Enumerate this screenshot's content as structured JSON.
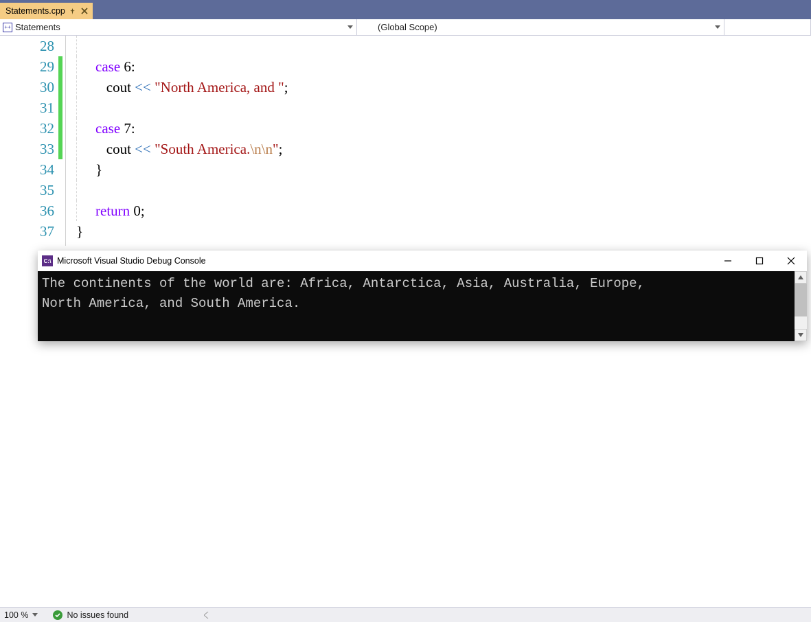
{
  "tab": {
    "filename": "Statements.cpp"
  },
  "scope": {
    "breadcrumb": "Statements",
    "scope_label": "(Global Scope)"
  },
  "code": {
    "lines": [
      {
        "n": "28"
      },
      {
        "n": "29",
        "kw": "case",
        "num": "6",
        "colon": ":"
      },
      {
        "n": "30",
        "id": "cout ",
        "op": "<<",
        "str_open": " \"",
        "str": "North America, and ",
        "str_close": "\"",
        "semi": ";"
      },
      {
        "n": "31"
      },
      {
        "n": "32",
        "kw": "case",
        "num": "7",
        "colon": ":"
      },
      {
        "n": "33",
        "id": "cout ",
        "op": "<<",
        "str_open": " \"",
        "str": "South America.",
        "esc": "\\n\\n",
        "str_close": "\"",
        "semi": ";"
      },
      {
        "n": "34",
        "brace": "}"
      },
      {
        "n": "35"
      },
      {
        "n": "36",
        "kw": "return",
        "num": "0",
        "semi": ";"
      },
      {
        "n": "37",
        "brace": "}"
      }
    ]
  },
  "console": {
    "title": "Microsoft Visual Studio Debug Console",
    "icon_text": "C:\\",
    "output_line1": "The continents of the world are: Africa, Antarctica, Asia, Australia, Europe,",
    "output_line2": "North America, and South America."
  },
  "status": {
    "zoom": "100 %",
    "issues": "No issues found"
  }
}
